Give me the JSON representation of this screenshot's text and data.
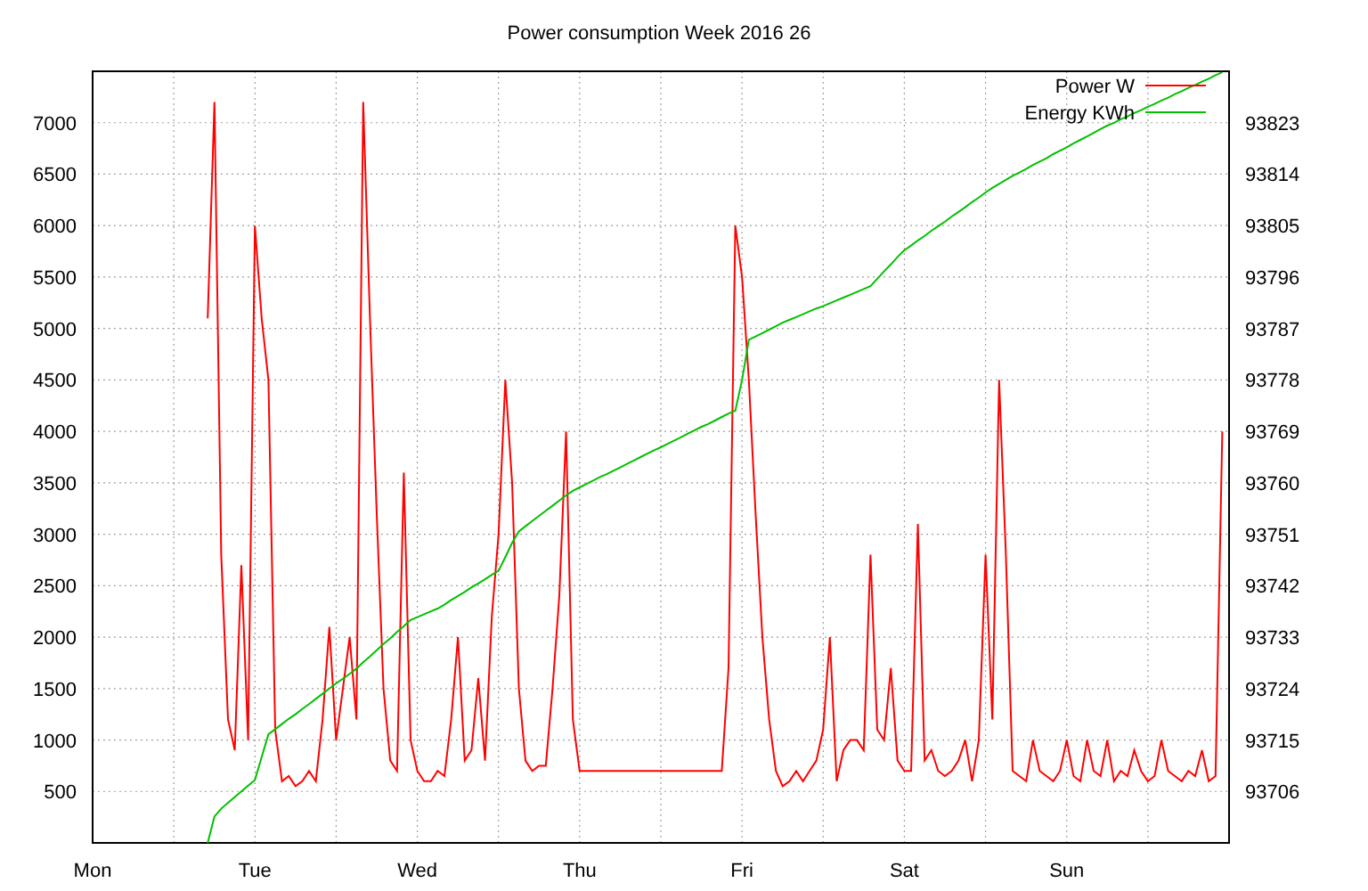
{
  "chart_data": {
    "type": "line",
    "title": "Power consumption Week 2016 26",
    "grid": true,
    "legend": true,
    "categories": [
      "Mon",
      null,
      null,
      null,
      null,
      null,
      null,
      null,
      null,
      null,
      null,
      null,
      null,
      null,
      null,
      null,
      null,
      null,
      null,
      null,
      null,
      null,
      null,
      null,
      "Tue",
      null,
      null,
      null,
      null,
      null,
      null,
      null,
      null,
      null,
      null,
      null,
      null,
      null,
      null,
      null,
      null,
      null,
      null,
      null,
      null,
      null,
      null,
      null,
      "Wed",
      null,
      null,
      null,
      null,
      null,
      null,
      null,
      null,
      null,
      null,
      null,
      null,
      null,
      null,
      null,
      null,
      null,
      null,
      null,
      null,
      null,
      null,
      null,
      "Thu",
      null,
      null,
      null,
      null,
      null,
      null,
      null,
      null,
      null,
      null,
      null,
      null,
      null,
      null,
      null,
      null,
      null,
      null,
      null,
      null,
      null,
      null,
      null,
      "Fri",
      null,
      null,
      null,
      null,
      null,
      null,
      null,
      null,
      null,
      null,
      null,
      null,
      null,
      null,
      null,
      null,
      null,
      null,
      null,
      null,
      null,
      null,
      null,
      "Sat",
      null,
      null,
      null,
      null,
      null,
      null,
      null,
      null,
      null,
      null,
      null,
      null,
      null,
      null,
      null,
      null,
      null,
      null,
      null,
      null,
      null,
      null,
      null,
      "Sun",
      null,
      null,
      null,
      null,
      null,
      null,
      null,
      null,
      null,
      null,
      null,
      null,
      null,
      null,
      null,
      null,
      null,
      null,
      null,
      null,
      null,
      null,
      null
    ],
    "ylim": [
      0,
      7500
    ],
    "yticks": [
      500,
      1000,
      1500,
      2000,
      2500,
      3000,
      3500,
      4000,
      4500,
      5000,
      5500,
      6000,
      6500,
      7000
    ],
    "y2lim": [
      93697,
      93832
    ],
    "y2ticks": [
      93706,
      93715,
      93724,
      93733,
      93742,
      93751,
      93760,
      93769,
      93778,
      93787,
      93796,
      93805,
      93814,
      93823
    ],
    "series": [
      {
        "name": "Power W",
        "color": "#ff0000",
        "axis": "y",
        "values": [
          null,
          null,
          null,
          null,
          null,
          null,
          null,
          null,
          null,
          null,
          null,
          null,
          null,
          null,
          null,
          null,
          null,
          5100,
          7200,
          2800,
          1200,
          900,
          2700,
          1000,
          6000,
          5100,
          4500,
          1100,
          600,
          650,
          550,
          600,
          700,
          600,
          1200,
          2100,
          1000,
          1500,
          2000,
          1200,
          7200,
          5100,
          3200,
          1500,
          800,
          700,
          3600,
          1000,
          700,
          600,
          600,
          700,
          650,
          1200,
          2000,
          800,
          900,
          1600,
          800,
          2200,
          3000,
          4500,
          3500,
          1500,
          800,
          700,
          750,
          750,
          1500,
          2400,
          4000,
          1200,
          700,
          700,
          700,
          700,
          700,
          700,
          700,
          700,
          700,
          700,
          700,
          700,
          700,
          700,
          700,
          700,
          700,
          700,
          700,
          700,
          700,
          700,
          1700,
          6000,
          5500,
          4500,
          3200,
          2000,
          1200,
          700,
          550,
          600,
          700,
          600,
          700,
          800,
          1100,
          2000,
          600,
          900,
          1000,
          1000,
          900,
          2800,
          1100,
          1000,
          1700,
          800,
          700,
          700,
          3100,
          800,
          900,
          700,
          650,
          700,
          800,
          1000,
          600,
          1000,
          2800,
          1200,
          4500,
          2800,
          700,
          650,
          600,
          1000,
          700,
          650,
          600,
          700,
          1000,
          650,
          600,
          1000,
          700,
          650,
          1000,
          600,
          700,
          650,
          900,
          700,
          600,
          650,
          1000,
          700,
          650,
          600,
          700,
          650,
          900,
          600,
          650,
          4000
        ]
      },
      {
        "name": "Energy KWh",
        "color": "#00c000",
        "axis": "y2",
        "values": [
          null,
          null,
          null,
          null,
          null,
          null,
          null,
          null,
          null,
          null,
          null,
          null,
          null,
          null,
          null,
          null,
          null,
          93697,
          93701.6,
          93703,
          93704,
          93705,
          93706,
          93707,
          93708,
          93712,
          93716,
          93716.9,
          93717.8,
          93718.7,
          93719.5,
          93720.4,
          93721.3,
          93722.2,
          93723.1,
          93724,
          93724.9,
          93725.7,
          93726.6,
          93727.5,
          93728.6,
          93729.6,
          93730.7,
          93731.8,
          93732.8,
          93733.9,
          93734.9,
          93736,
          93736.5,
          93737,
          93737.5,
          93738,
          93738.7,
          93739.5,
          93740.2,
          93740.9,
          93741.7,
          93742.4,
          93743.1,
          93743.9,
          93744.6,
          93747,
          93749.5,
          93751.5,
          93752.4,
          93753.3,
          93754.2,
          93755.1,
          93756,
          93756.9,
          93757.8,
          93758.6,
          93759.2,
          93759.8,
          93760.4,
          93761,
          93761.5,
          93762.1,
          93762.7,
          93763.3,
          93763.9,
          93764.5,
          93765.1,
          93765.7,
          93766.2,
          93766.8,
          93767.4,
          93768,
          93768.6,
          93769.2,
          93769.8,
          93770.3,
          93770.9,
          93771.5,
          93772.1,
          93772.6,
          93778,
          93785,
          93785.6,
          93786.2,
          93786.8,
          93787.4,
          93788,
          93788.5,
          93789,
          93789.5,
          93790,
          93790.5,
          93790.9,
          93791.4,
          93791.9,
          93792.4,
          93792.9,
          93793.4,
          93793.9,
          93794.4,
          93795.7,
          93797,
          93798.2,
          93799.5,
          93800.7,
          93801.5,
          93802.4,
          93803.2,
          93804.1,
          93804.9,
          93805.7,
          93806.6,
          93807.4,
          93808.2,
          93809.1,
          93809.9,
          93810.8,
          93811.6,
          93812.3,
          93813,
          93813.7,
          93814.3,
          93814.9,
          93815.6,
          93816.2,
          93816.8,
          93817.5,
          93818.1,
          93818.7,
          93819.4,
          93820,
          93820.6,
          93821.2,
          93821.9,
          93822.5,
          93823,
          93823.6,
          93824.1,
          93824.7,
          93825.2,
          93825.8,
          93826.3,
          93826.9,
          93827.4,
          93828,
          93828.5,
          93829.1,
          93829.6,
          93830.2,
          93830.7,
          93831.3,
          93831.8
        ]
      }
    ]
  }
}
